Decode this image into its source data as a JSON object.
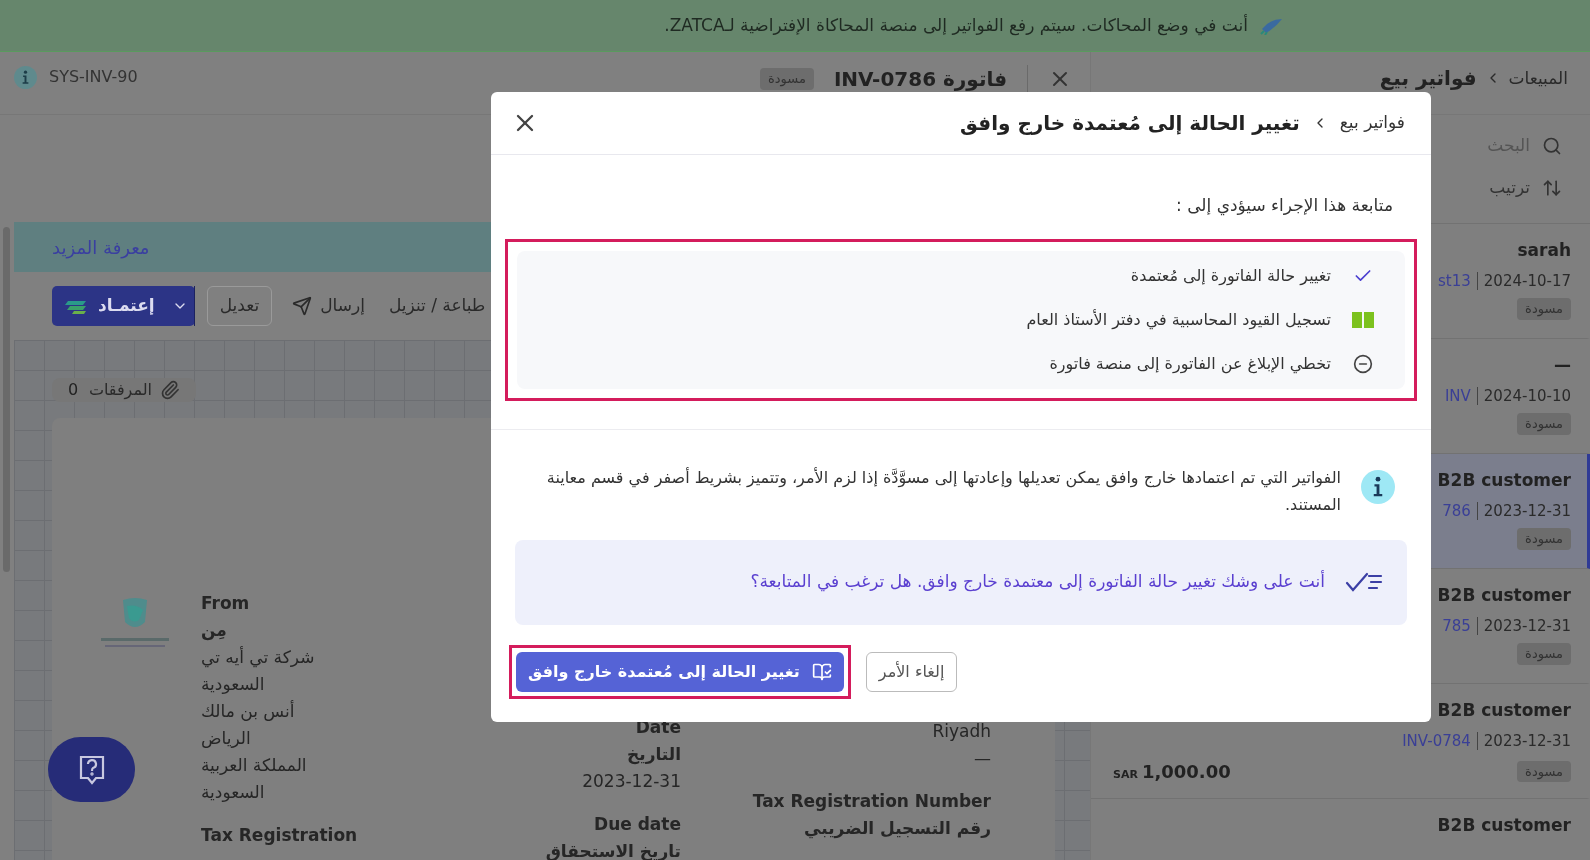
{
  "banner": {
    "text": "أنت في وضع المحاكات. سيتم رفع الفواتير إلى منصة المحاكاة الإفتراضية لـZATCA."
  },
  "sidebar": {
    "breadcrumb": [
      "المبيعات",
      "فواتير بيع"
    ],
    "search_placeholder": "البحث",
    "sort": "ترتيب",
    "invoices": [
      {
        "customer": "sarah",
        "number": "st13",
        "date": "2024-10-17",
        "status": "مسودة",
        "selected": false
      },
      {
        "customer": "—",
        "number": "INV",
        "date": "2024-10-10",
        "status": "مسودة",
        "selected": false
      },
      {
        "customer": "B2B customer",
        "number": "786",
        "date": "2023-12-31",
        "status": "مسودة",
        "selected": true
      },
      {
        "customer": "B2B customer",
        "number": "785",
        "date": "2023-12-31",
        "status": "مسودة",
        "selected": false
      },
      {
        "customer": "B2B customer",
        "number": "INV-0784",
        "date": "2023-12-31",
        "status": "مسودة",
        "currency": "SAR",
        "amount": "1,000.00",
        "selected": false
      },
      {
        "customer": "B2B customer",
        "selected": false
      }
    ]
  },
  "invoice_header": {
    "title": "فاتورة INV-0786",
    "status": "مسودة",
    "system_id": "SYS-INV-90"
  },
  "learn_more": "معرفة المزيد",
  "toolbar": [
    {
      "kind": "plain",
      "label": "طباعة / تنزيل"
    },
    {
      "kind": "send",
      "label": "إرسال"
    },
    {
      "kind": "outline",
      "label": "تعديل"
    },
    {
      "kind": "approve",
      "label": "إعتمـاد"
    }
  ],
  "attachments": {
    "label": "المرفقات",
    "count": "0"
  },
  "document": {
    "sender": [
      {
        "kind": "label",
        "text": "From"
      },
      {
        "kind": "label",
        "text": "مِن"
      },
      {
        "kind": "value",
        "text": "شركة تي أيه تي السعودية"
      },
      {
        "kind": "value",
        "text": "أنس بن مالك"
      },
      {
        "kind": "value",
        "text": "الرياض"
      },
      {
        "kind": "value",
        "text": "المملكة العربية السعودية"
      },
      {
        "kind": "label",
        "text": "Tax Registration"
      }
    ],
    "dates": [
      {
        "kind": "label",
        "text": "Date"
      },
      {
        "kind": "label",
        "text": "التاريخ"
      },
      {
        "kind": "value",
        "text": "2023-12-31"
      },
      {
        "kind": "label",
        "text": "Due date"
      },
      {
        "kind": "label",
        "text": "تاريخ الاستحقاق"
      }
    ],
    "customer": [
      {
        "kind": "value",
        "text": "Riyadh"
      },
      {
        "kind": "value",
        "text": "—"
      },
      {
        "kind": "label",
        "text": "Tax Registration Number"
      },
      {
        "kind": "label",
        "text": "رقم التسجيل الضريبي"
      }
    ]
  },
  "modal": {
    "breadcrumb": [
      "فواتير بيع",
      "تغيير الحالة إلى مُعتمدة خارج وافق"
    ],
    "intro": "متابعة هذا الإجراء سيؤدي إلى :",
    "effects_highlighted": true,
    "effects": [
      {
        "kind": "done",
        "text": "تغيير حالة الفاتورة إلى مُعتمدة"
      },
      {
        "kind": "ledger",
        "text": "تسجيل القيود المحاسبية في دفتر الأستاذ العام"
      },
      {
        "kind": "skipped",
        "text": "تخطي الإبلاغ عن الفاتورة إلى منصة فاتورة"
      }
    ],
    "note": "الفواتير التي تم اعتمادها خارج وافق يمكن تعديلها وإعادتها إلى مسوَّدَّة إذا لزم الأمر، وتتميز بشريط أصفر في قسم معاينة المستند.",
    "confirm": "أنت على وشك تغيير حالة الفاتورة إلى معتمدة خارج وافق. هل ترغب في المتابعة؟",
    "buttons": [
      {
        "kind": "cancel",
        "label": "إلغاء الأمر",
        "highlighted": false
      },
      {
        "kind": "primary",
        "label": "تغيير الحالة إلى مُعتمدة خارج وافق",
        "highlighted": true
      }
    ]
  }
}
